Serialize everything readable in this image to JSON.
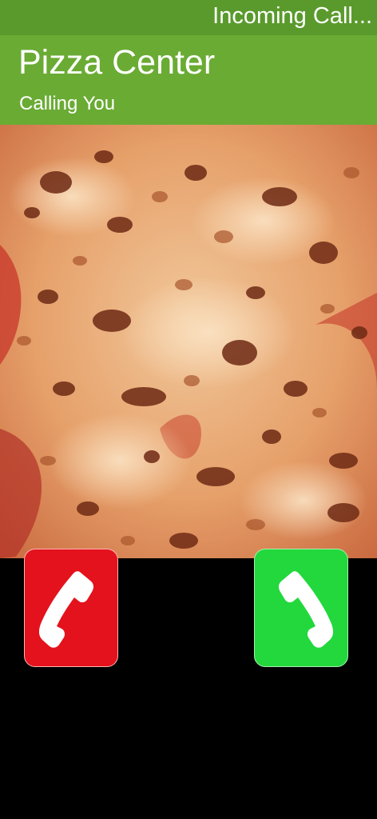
{
  "status_bar": {
    "text": "Incoming Call..."
  },
  "caller": {
    "name": "Pizza Center",
    "status": "Calling You"
  },
  "photo": {
    "subject": "pizza-cheese-closeup"
  },
  "actions": {
    "decline_icon": "phone-handset-icon",
    "accept_icon": "phone-handset-icon"
  },
  "colors": {
    "status_bar_bg": "#5a9a2c",
    "header_bg": "#6aab34",
    "decline": "#e4121c",
    "accept": "#22d83c",
    "background": "#000000"
  }
}
